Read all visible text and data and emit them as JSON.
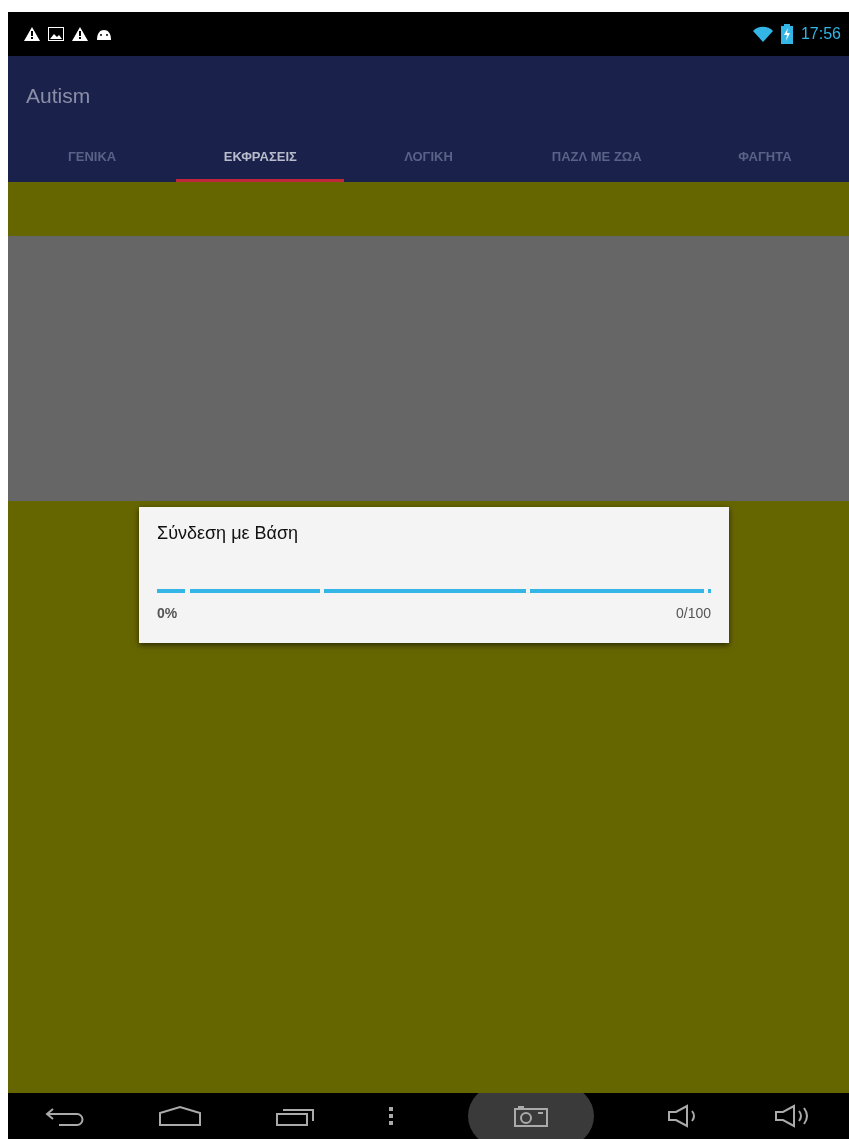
{
  "status_bar": {
    "time": "17:56"
  },
  "app_bar": {
    "title": "Autism"
  },
  "tabs": [
    {
      "label": "ΓΕΝΙΚΑ",
      "selected": false
    },
    {
      "label": "ΕΚΦΡΑΣΕΙΣ",
      "selected": true
    },
    {
      "label": "ΛΟΓΙΚΗ",
      "selected": false
    },
    {
      "label": "ΠΑΖΛ ΜΕ ΖΩΑ",
      "selected": false
    },
    {
      "label": "ΦΑΓΗΤΑ",
      "selected": false
    }
  ],
  "dialog": {
    "title": "Σύνδεση με Βάση",
    "percent": "0%",
    "count": "0/100",
    "progress": {
      "indeterminate": true
    }
  }
}
